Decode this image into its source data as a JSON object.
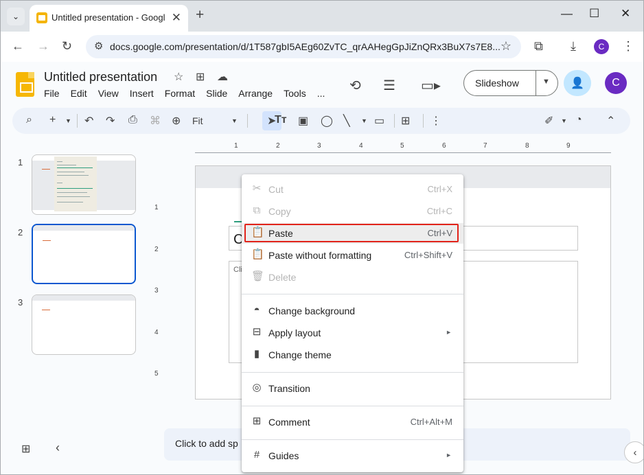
{
  "browser": {
    "tab_title": "Untitled presentation - Google",
    "tab_close": "✕",
    "new_tab": "+",
    "url": "docs.google.com/presentation/d/1T587gbI5AEg60ZvTC_qrAAHegGpJiZnQRx3BuX7s7E8...",
    "profile_initial": "C",
    "window_controls": {
      "minimize": "—",
      "maximize": "☐",
      "close": "✕"
    }
  },
  "app": {
    "doc_title": "Untitled presentation",
    "menu": [
      "File",
      "Edit",
      "View",
      "Insert",
      "Format",
      "Slide",
      "Arrange",
      "Tools",
      "..."
    ],
    "slideshow_label": "Slideshow",
    "avatar_initial": "C"
  },
  "toolbar": {
    "zoom": "Fit"
  },
  "filmstrip": {
    "slides": [
      {
        "number": "1"
      },
      {
        "number": "2",
        "active": true
      },
      {
        "number": "3"
      }
    ]
  },
  "rulers": {
    "horizontal": [
      "1",
      "2",
      "3",
      "4",
      "5",
      "6",
      "7",
      "8",
      "9"
    ],
    "vertical": [
      "1",
      "2",
      "3",
      "4",
      "5"
    ]
  },
  "slide": {
    "title_text": "C",
    "body_text": "Cli"
  },
  "notes": {
    "placeholder": "Click to add sp"
  },
  "context_menu": {
    "items": [
      {
        "label": "Cut",
        "shortcut": "Ctrl+X",
        "icon": "scissors-icon",
        "disabled": true
      },
      {
        "label": "Copy",
        "shortcut": "Ctrl+C",
        "icon": "copy-icon",
        "disabled": true
      },
      {
        "label": "Paste",
        "shortcut": "Ctrl+V",
        "icon": "clipboard-icon",
        "highlighted": true
      },
      {
        "label": "Paste without formatting",
        "shortcut": "Ctrl+Shift+V",
        "icon": "clipboard-plain-icon"
      },
      {
        "label": "Delete",
        "shortcut": "",
        "icon": "trash-icon",
        "disabled": true
      },
      {
        "label": "Change background",
        "shortcut": "",
        "icon": "fill-icon"
      },
      {
        "label": "Apply layout",
        "shortcut": "",
        "icon": "layout-icon",
        "submenu": true
      },
      {
        "label": "Change theme",
        "shortcut": "",
        "icon": "paint-roller-icon"
      },
      {
        "label": "Transition",
        "shortcut": "",
        "icon": "transition-icon"
      },
      {
        "label": "Comment",
        "shortcut": "Ctrl+Alt+M",
        "icon": "add-comment-icon"
      },
      {
        "label": "Guides",
        "shortcut": "",
        "icon": "grid-icon",
        "submenu": true
      }
    ],
    "highlight_color": "#e2231a"
  },
  "colors": {
    "accent_blue": "#0b57d0",
    "slides_yellow": "#f6b704",
    "avatar_purple": "#6a2bc2"
  }
}
